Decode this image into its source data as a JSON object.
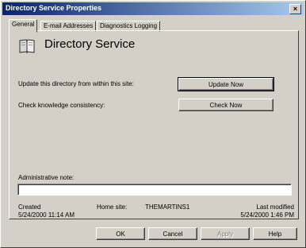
{
  "window": {
    "title": "Directory Service Properties",
    "close_glyph": "×"
  },
  "tabs": [
    {
      "label": "General",
      "active": true
    },
    {
      "label": "E-mail Addresses",
      "active": false
    },
    {
      "label": "Diagnostics Logging",
      "active": false
    }
  ],
  "general": {
    "heading": "Directory Service",
    "update_label": "Update this directory from within this site:",
    "update_button": "Update Now",
    "check_label": "Check knowledge consistency:",
    "check_button": "Check Now",
    "note_label": "Administrative note:",
    "note_value": "",
    "created_label": "Created",
    "created_value": "5/24/2000 11:14 AM",
    "home_site_label": "Home site:",
    "home_site_value": "THEMARTINS1",
    "modified_label": "Last modified",
    "modified_value": "5/24/2000 1:46 PM"
  },
  "buttons": {
    "ok": "OK",
    "cancel": "Cancel",
    "apply": "Apply",
    "help": "Help"
  }
}
